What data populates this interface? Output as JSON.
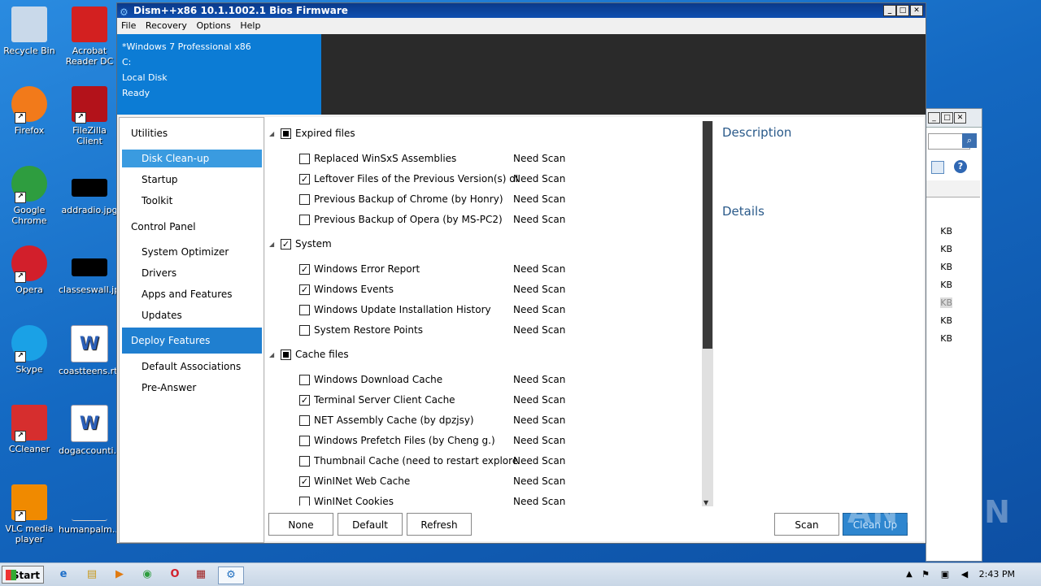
{
  "desktop": {
    "icons": [
      {
        "label": "Recycle Bin",
        "icon": "recycle-bin-icon",
        "color": "#c9d9ea"
      },
      {
        "label": "Acrobat Reader DC",
        "icon": "acrobat-icon",
        "color": "#d32020"
      },
      {
        "label": "Firefox",
        "icon": "firefox-icon",
        "color": "#f27a1a"
      },
      {
        "label": "FileZilla Client",
        "icon": "filezilla-icon",
        "color": "#b3121a"
      },
      {
        "label": "Google Chrome",
        "icon": "chrome-icon",
        "color": "#2e9d3f"
      },
      {
        "label": "addradio.jpg",
        "icon": "image-file-icon",
        "color": "#000000"
      },
      {
        "label": "Opera",
        "icon": "opera-icon",
        "color": "#d21f2b"
      },
      {
        "label": "classeswall.jpg",
        "icon": "image-file-icon",
        "color": "#000000"
      },
      {
        "label": "Skype",
        "icon": "skype-icon",
        "color": "#1aa1e6"
      },
      {
        "label": "coastteens.rtf",
        "icon": "word-doc-icon",
        "color": "#2b5fb8"
      },
      {
        "label": "CCleaner",
        "icon": "ccleaner-icon",
        "color": "#d62e2e"
      },
      {
        "label": "dogaccounti...",
        "icon": "word-doc-icon",
        "color": "#2b5fb8"
      },
      {
        "label": "VLC media player",
        "icon": "vlc-icon",
        "color": "#f08a00"
      },
      {
        "label": "humanpalm...",
        "icon": "file-icon",
        "color": "#1a6bc9"
      }
    ]
  },
  "window": {
    "title": "Dism++x86 10.1.1002.1 Bios Firmware",
    "menu": [
      "File",
      "Recovery",
      "Options",
      "Help"
    ],
    "info": [
      "*Windows 7 Professional x86",
      "C:",
      "Local Disk",
      "Ready"
    ]
  },
  "sidebar": {
    "groups": [
      {
        "label": "Utilities",
        "items": [
          "Disk Clean-up",
          "Startup",
          "Toolkit"
        ]
      },
      {
        "label": "Control Panel",
        "items": [
          "System Optimizer",
          "Drivers",
          "Apps and Features",
          "Updates"
        ]
      },
      {
        "label": "Deploy Features",
        "items": [
          "Default Associations",
          "Pre-Answer"
        ]
      }
    ],
    "selected_item": "Disk Clean-up",
    "highlighted_group": "Deploy Features"
  },
  "cleanup": {
    "status_label": "Need Scan",
    "categories": [
      {
        "label": "Expired files",
        "state": "partial",
        "items": [
          {
            "label": "Replaced WinSxS Assemblies",
            "checked": false
          },
          {
            "label": "Leftover Files of the Previous Version(s) of Dism",
            "checked": true
          },
          {
            "label": "Previous Backup of Chrome (by Honry)",
            "checked": false
          },
          {
            "label": "Previous Backup of Opera (by MS-PC2)",
            "checked": false
          }
        ]
      },
      {
        "label": "System",
        "state": "checked",
        "items": [
          {
            "label": "Windows Error Report",
            "checked": true
          },
          {
            "label": "Windows Events",
            "checked": true
          },
          {
            "label": "Windows Update Installation History",
            "checked": false
          },
          {
            "label": "System Restore Points",
            "checked": false
          }
        ]
      },
      {
        "label": "Cache files",
        "state": "partial",
        "items": [
          {
            "label": "Windows Download Cache",
            "checked": false
          },
          {
            "label": "Terminal Server Client Cache",
            "checked": true
          },
          {
            "label": "NET Assembly Cache (by dpzjsy)",
            "checked": false
          },
          {
            "label": "Windows Prefetch Files (by Cheng g.)",
            "checked": false
          },
          {
            "label": "Thumbnail Cache (need to restart explorer)",
            "checked": false
          },
          {
            "label": "WinINet Web Cache",
            "checked": true
          },
          {
            "label": "WinINet Cookies",
            "checked": false
          }
        ]
      }
    ]
  },
  "panel": {
    "description_heading": "Description",
    "details_heading": "Details"
  },
  "buttons": {
    "none": "None",
    "default": "Default",
    "refresh": "Refresh",
    "scan": "Scan",
    "cleanup": "Clean Up"
  },
  "bg_window": {
    "sizes": [
      "KB",
      "KB",
      "KB",
      "KB",
      "KB",
      "KB",
      "KB"
    ]
  },
  "taskbar": {
    "start_label": "Start",
    "time": "2:43 PM"
  },
  "watermark": "ANY RUN"
}
